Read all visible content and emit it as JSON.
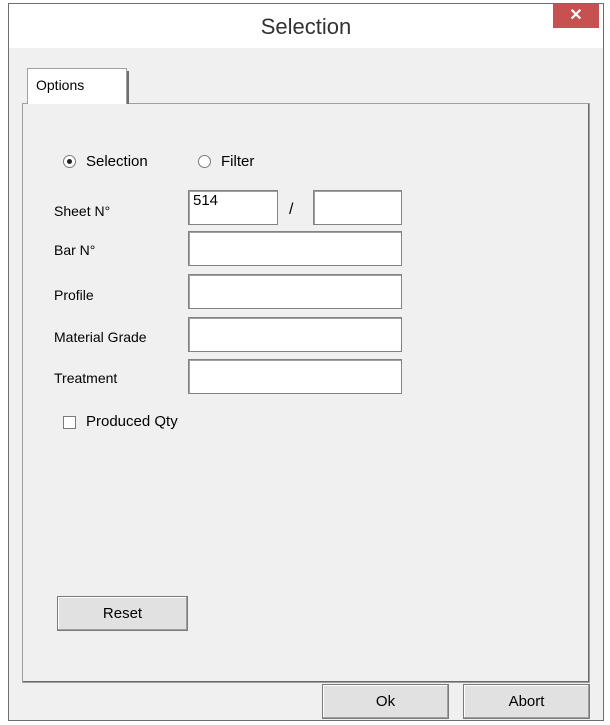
{
  "window": {
    "title": "Selection",
    "close_glyph": "✕"
  },
  "tabs": [
    {
      "label": "Options"
    }
  ],
  "mode": {
    "selection_label": "Selection",
    "filter_label": "Filter",
    "selected": "selection"
  },
  "fields": {
    "sheet": {
      "label": "Sheet N°",
      "value": "514",
      "separator": "/",
      "total": ""
    },
    "bar": {
      "label": "Bar N°",
      "value": ""
    },
    "profile": {
      "label": "Profile",
      "value": ""
    },
    "material_grade": {
      "label": "Material Grade",
      "value": ""
    },
    "treatment": {
      "label": "Treatment",
      "value": ""
    }
  },
  "produced_qty": {
    "label": "Produced Qty",
    "checked": false
  },
  "buttons": {
    "reset": "Reset",
    "ok": "Ok",
    "abort": "Abort"
  }
}
